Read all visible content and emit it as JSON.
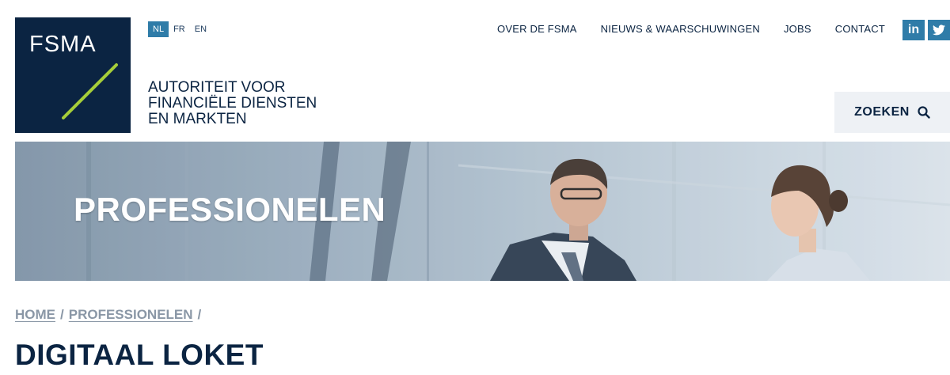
{
  "logo": {
    "text": "FSMA",
    "line_color": "#a6ce39",
    "bg_color": "#0b2442"
  },
  "languages": [
    {
      "code": "NL",
      "active": true
    },
    {
      "code": "FR",
      "active": false
    },
    {
      "code": "EN",
      "active": false
    }
  ],
  "tagline": {
    "line1": "AUTORITEIT VOOR",
    "line2": "FINANCIËLE DIENSTEN",
    "line3": "EN MARKTEN"
  },
  "nav": {
    "items": [
      {
        "label": "OVER DE FSMA"
      },
      {
        "label": "NIEUWS & WAARSCHUWINGEN"
      },
      {
        "label": "JOBS"
      },
      {
        "label": "CONTACT"
      }
    ]
  },
  "social": {
    "linkedin_icon": "linkedin-icon",
    "twitter_icon": "twitter-icon",
    "linkedin_label": "in"
  },
  "search": {
    "label": "ZOEKEN",
    "icon": "search-icon"
  },
  "hero": {
    "title": "PROFESSIONELEN"
  },
  "breadcrumb": {
    "home": "HOME",
    "section": "PROFESSIONELEN",
    "separator": "/"
  },
  "page": {
    "title": "DIGITAAL LOKET"
  },
  "colors": {
    "accent": "#2f7ca8",
    "navy": "#0b2442",
    "muted": "#8a97a6"
  }
}
